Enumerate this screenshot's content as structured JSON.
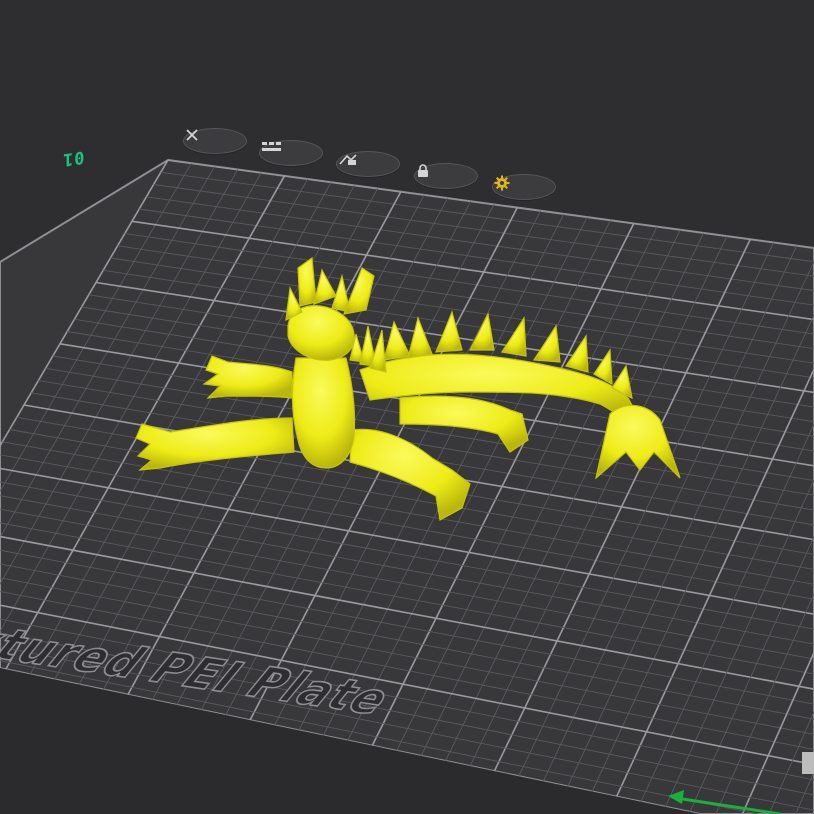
{
  "viewport": {
    "plate_number": "01",
    "plate_label": "xtured PEI Plate",
    "colors": {
      "background": "#2e2e30",
      "plate": "#38383b",
      "grid_minor": "#5a5a5e",
      "grid_major": "#9a9a9e",
      "model": "#f0ee1a",
      "plate_number": "#16c47f",
      "axis_x": "#18b23a"
    }
  },
  "plate_toolbar": {
    "buttons": [
      {
        "name": "remove-plate",
        "icon": "close-icon"
      },
      {
        "name": "arrange",
        "icon": "arrange-icon"
      },
      {
        "name": "auto-orient",
        "icon": "auto-orient-icon"
      },
      {
        "name": "lock",
        "icon": "lock-icon"
      },
      {
        "name": "plate-settings",
        "icon": "gear-icon"
      }
    ]
  }
}
